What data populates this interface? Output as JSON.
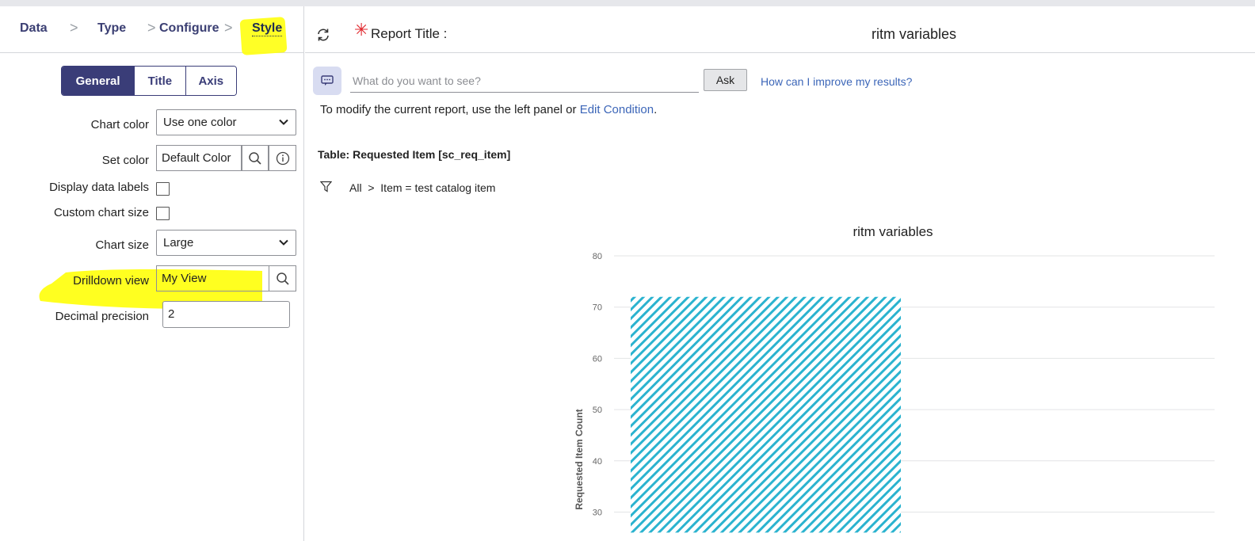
{
  "breadcrumb": {
    "steps": [
      "Data",
      "Type",
      "Configure",
      "Style"
    ],
    "separator": ">"
  },
  "style_tabs": [
    "General",
    "Title",
    "Axis"
  ],
  "form": {
    "chart_color": {
      "label": "Chart color",
      "value": "Use one color"
    },
    "set_color": {
      "label": "Set color",
      "value": "Default Color"
    },
    "display_data_labels": {
      "label": "Display data labels",
      "checked": false
    },
    "custom_chart_size": {
      "label": "Custom chart size",
      "checked": false
    },
    "chart_size": {
      "label": "Chart size",
      "value": "Large"
    },
    "drilldown_view": {
      "label": "Drilldown view",
      "value": "My View"
    },
    "decimal_precision": {
      "label": "Decimal precision",
      "value": "2"
    }
  },
  "report": {
    "title_label": "Report Title :",
    "title_value": "ritm variables",
    "ask_placeholder": "What do you want to see?",
    "ask_button": "Ask",
    "improve_link": "How can I improve my results?",
    "modify_text": "To modify the current report, use the left panel or",
    "modify_link": "Edit Condition",
    "modify_end": ".",
    "table_label": "Table: Requested Item [sc_req_item]",
    "filter_text": "All  >  Item = test catalog item"
  },
  "colors": {
    "accent": "#3a3d78",
    "highlight": "#ffff14",
    "bar": "#2bb3cf",
    "link": "#3c66b8",
    "required": "#e0252b"
  },
  "chart_data": {
    "type": "bar",
    "title": "ritm variables",
    "ylabel": "Requested Item Count",
    "xlabel": "",
    "categories": [
      ""
    ],
    "values": [
      72
    ],
    "y_ticks": [
      30,
      40,
      50,
      60,
      70,
      80
    ],
    "ylim": [
      26,
      80
    ],
    "grid": true
  }
}
